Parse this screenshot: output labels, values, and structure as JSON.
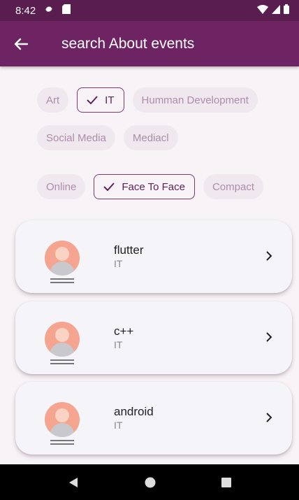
{
  "status_bar": {
    "time": "8:42"
  },
  "app_bar": {
    "title": "search About events"
  },
  "category_chips": [
    {
      "label": "Art",
      "selected": false
    },
    {
      "label": "IT",
      "selected": true
    },
    {
      "label": "Humman Development",
      "selected": false
    },
    {
      "label": "Social Media",
      "selected": false
    },
    {
      "label": "Mediacl",
      "selected": false
    }
  ],
  "mode_chips": [
    {
      "label": "Online",
      "selected": false
    },
    {
      "label": "Face To Face",
      "selected": true
    },
    {
      "label": "Compact",
      "selected": false
    }
  ],
  "events": [
    {
      "title": "flutter",
      "category": "IT"
    },
    {
      "title": "c++",
      "category": "IT"
    },
    {
      "title": "android",
      "category": "IT"
    }
  ],
  "colors": {
    "status_bar": "#5a1d4f",
    "app_bar": "#6e2363",
    "chip_bg": "#efe9ef",
    "chip_text": "#b08aab",
    "selected_border": "#7a3a70"
  }
}
